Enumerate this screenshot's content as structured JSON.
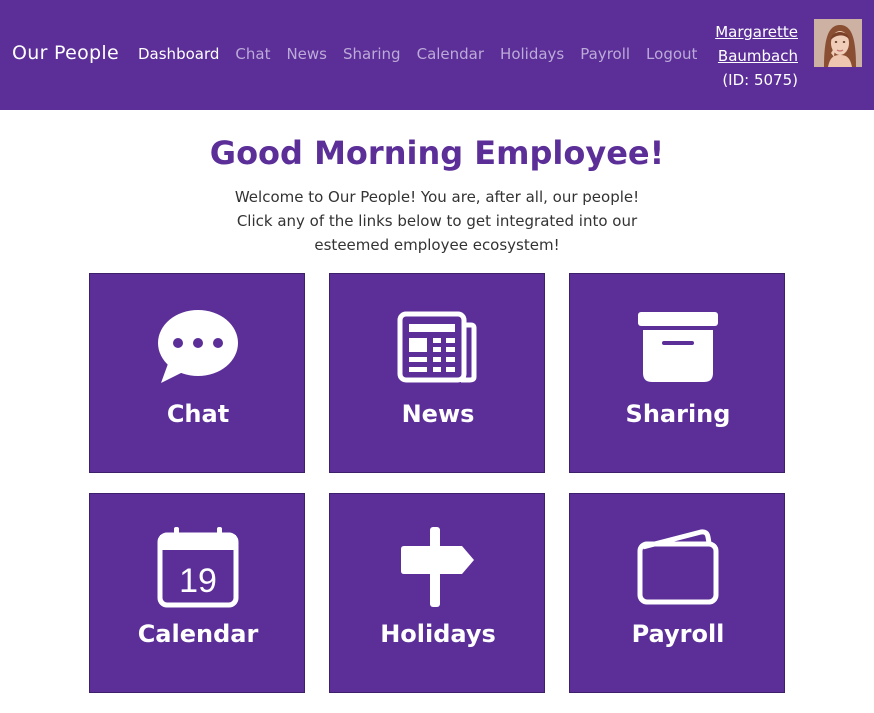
{
  "brand": "Our People",
  "nav": {
    "items": [
      {
        "label": "Dashboard",
        "active": true
      },
      {
        "label": "Chat",
        "active": false
      },
      {
        "label": "News",
        "active": false
      },
      {
        "label": "Sharing",
        "active": false
      },
      {
        "label": "Calendar",
        "active": false
      },
      {
        "label": "Holidays",
        "active": false
      },
      {
        "label": "Payroll",
        "active": false
      },
      {
        "label": "Logout",
        "active": false
      }
    ]
  },
  "user": {
    "first_name": "Margarette",
    "last_name": "Baumbach",
    "id_text": "(ID: 5075)"
  },
  "main": {
    "greeting": "Good Morning Employee!",
    "intro": "Welcome to Our People! You are, after all, our people! Click any of the links below to get integrated into our esteemed employee ecosystem!"
  },
  "tiles": [
    {
      "label": "Chat",
      "icon": "chat-bubble-icon"
    },
    {
      "label": "News",
      "icon": "newspaper-icon"
    },
    {
      "label": "Sharing",
      "icon": "archive-box-icon"
    },
    {
      "label": "Calendar",
      "icon": "calendar-icon",
      "icon_text": "19"
    },
    {
      "label": "Holidays",
      "icon": "signpost-icon"
    },
    {
      "label": "Payroll",
      "icon": "wallet-icon"
    }
  ],
  "colors": {
    "primary": "#5b2e98",
    "nav_inactive": "#bcaad8",
    "text": "#333333"
  }
}
